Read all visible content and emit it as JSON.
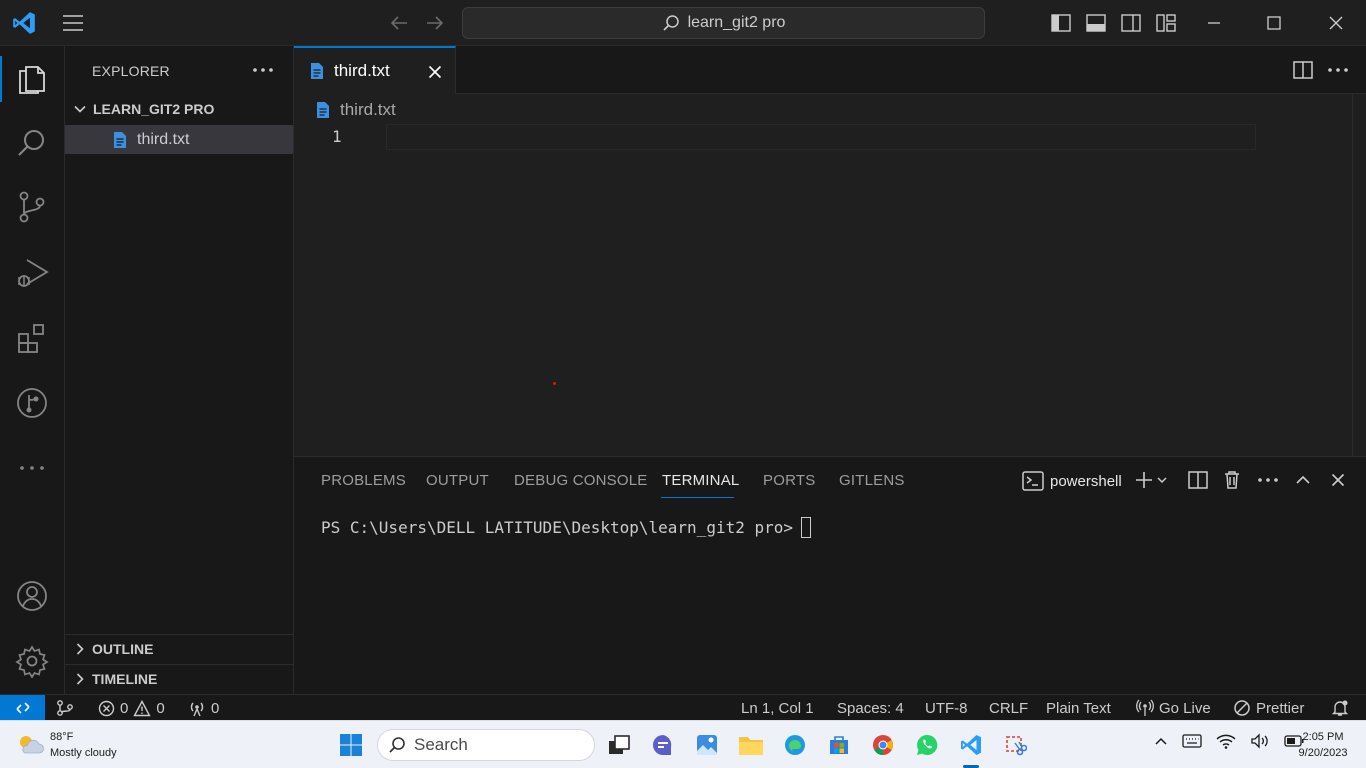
{
  "titlebar": {
    "search_text": "learn_git2 pro"
  },
  "sidebar": {
    "title": "EXPLORER",
    "folder": "LEARN_GIT2 PRO",
    "files": [
      "third.txt"
    ],
    "outline": "OUTLINE",
    "timeline": "TIMELINE"
  },
  "editor": {
    "tab_label": "third.txt",
    "breadcrumb": "third.txt",
    "line_number": "1",
    "colors": {
      "accent": "#0078d4",
      "file_icon": "#3d8fe0"
    }
  },
  "panel": {
    "tabs": [
      "PROBLEMS",
      "OUTPUT",
      "DEBUG CONSOLE",
      "TERMINAL",
      "PORTS",
      "GITLENS"
    ],
    "active_tab": "TERMINAL",
    "shell": "powershell",
    "prompt": "PS C:\\Users\\DELL LATITUDE\\Desktop\\learn_git2 pro>"
  },
  "statusbar": {
    "errors": "0",
    "warnings": "0",
    "ports": "0",
    "position": "Ln 1, Col 1",
    "spaces": "Spaces: 4",
    "encoding": "UTF-8",
    "eol": "CRLF",
    "language": "Plain Text",
    "golive": "Go Live",
    "prettier": "Prettier"
  },
  "taskbar": {
    "temperature": "88°F",
    "weather": "Mostly cloudy",
    "search": "Search",
    "time": "2:05 PM",
    "date": "9/20/2023"
  }
}
